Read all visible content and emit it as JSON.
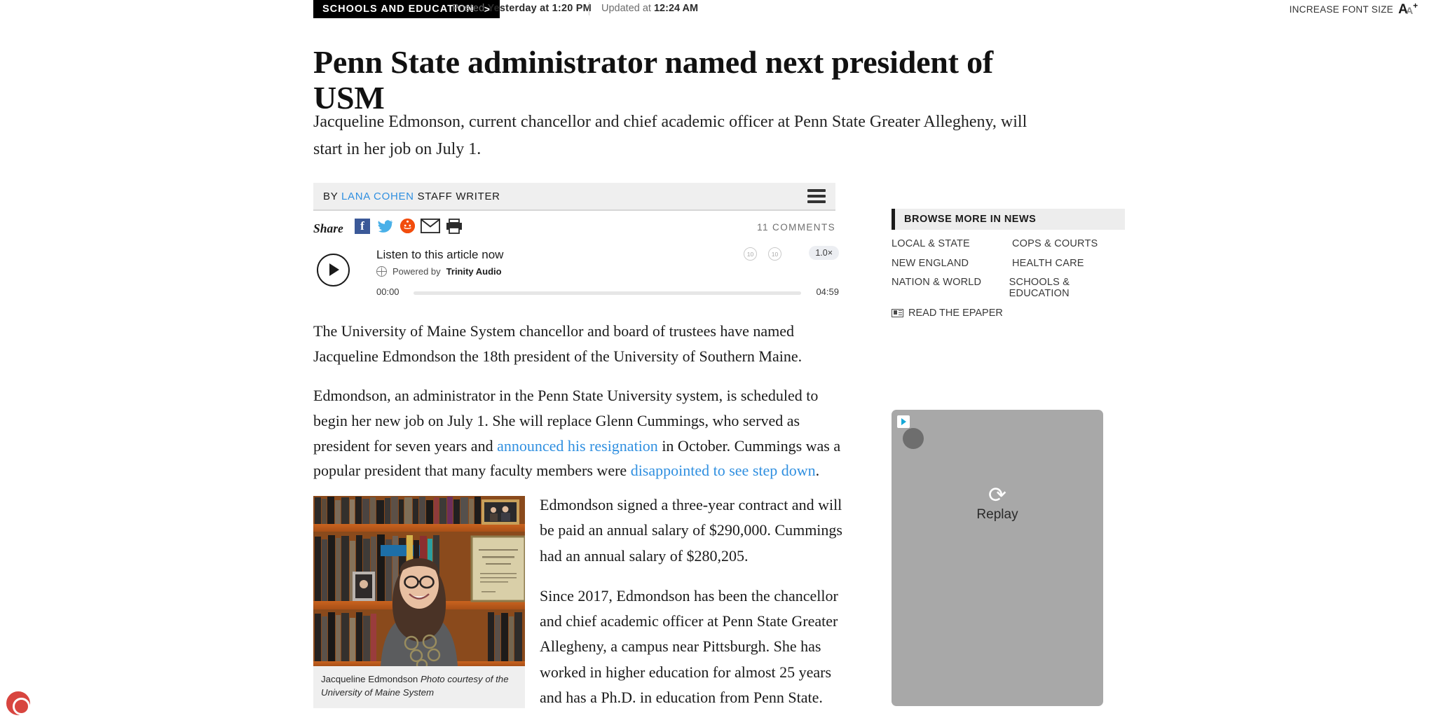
{
  "topbar": {
    "category": "SCHOOLS AND EDUCATION",
    "category_chevron": ">",
    "posted_label": "Posted ",
    "posted_value": "Yesterday at 1:20 PM",
    "updated_label": "Updated at ",
    "updated_value": "12:24 AM",
    "font_size_label": "INCREASE FONT SIZE",
    "font_glyph_big": "A",
    "font_glyph_small": "A",
    "font_glyph_plus": "+"
  },
  "article": {
    "headline": "Penn State administrator named next president of USM",
    "deck": "Jacqueline Edmonson, current chancellor and chief academic officer at Penn State Greater Allegheny, will start in her job on July 1.",
    "byline_prefix": "BY ",
    "byline_author": "LANA COHEN",
    "byline_role": " STAFF WRITER",
    "comments": "11 COMMENTS",
    "share_label": "Share",
    "paragraphs": [
      "The University of Maine System chancellor and board of trustees have named Jacqueline Edmondson the 18th president of the University of Southern Maine."
    ],
    "p2_a": "Edmondson, an administrator in the Penn State University system, is scheduled to begin her new job on July 1. She will replace Glenn Cummings, who served as president for seven years and ",
    "p2_link1": "announced his resignation",
    "p2_b": " in October. Cummings was a popular president that many faculty members were ",
    "p2_link2": "disappointed to see step down",
    "p2_c": ".",
    "right_paragraphs": [
      "Edmondson signed a three-year contract and will be paid an annual salary of $290,000. Cummings had an annual salary of $280,205.",
      "Since 2017, Edmondson has been the chancellor and chief academic officer at Penn State Greater Allegheny, a campus near Pittsburgh. She has worked in higher education for almost 25 years and has a Ph.D. in education from Penn State."
    ],
    "caption_name": "Jacqueline Edmondson ",
    "caption_credit": "Photo courtesy of the University of Maine System"
  },
  "share_icons": [
    {
      "name": "facebook-share-icon",
      "glyph": "f"
    },
    {
      "name": "twitter-share-icon",
      "glyph": "🐦"
    },
    {
      "name": "reddit-share-icon",
      "glyph": "Ⓦ"
    },
    {
      "name": "email-share-icon",
      "glyph": "✉"
    },
    {
      "name": "print-icon",
      "glyph": "⎙"
    }
  ],
  "player": {
    "title": "Listen to this article now",
    "powered_prefix": "Powered by ",
    "powered_brand": "Trinity Audio",
    "time_current": "00:00",
    "time_total": "04:59",
    "rate": "1.0×",
    "rewind": "10",
    "forward": "10",
    "progress_percent": 0
  },
  "sidebar": {
    "browse_title": "BROWSE MORE IN NEWS",
    "links": [
      {
        "col1": "LOCAL & STATE",
        "col2": "COPS & COURTS"
      },
      {
        "col1": "NEW ENGLAND",
        "col2": "HEALTH CARE"
      },
      {
        "col1": "NATION & WORLD",
        "col2": "SCHOOLS & EDUCATION"
      }
    ],
    "epaper": "READ THE EPAPER"
  },
  "ad": {
    "replay_label": "Replay",
    "replay_glyph": "⟳"
  },
  "colors": {
    "link": "#2f8fe0",
    "tag_bg": "#000000",
    "byline_bg": "#efefef",
    "accessibility": "#d8453f"
  }
}
